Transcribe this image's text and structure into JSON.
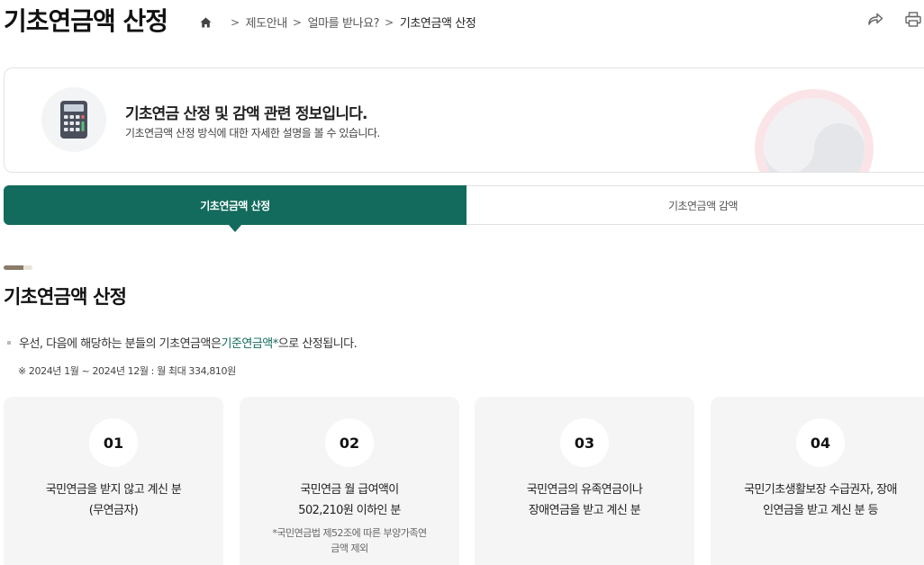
{
  "header": {
    "title": "기초연금액 산정",
    "breadcrumb": [
      "제도안내",
      "얼마를 받나요?",
      "기초연금액 산정"
    ],
    "icons": [
      "home-icon",
      "share-icon",
      "print-icon"
    ]
  },
  "intro": {
    "title": "기초연금 산정 및 감액 관련 정보입니다.",
    "description": "기초연금액 산정 방식에 대한 자세한 설명을 볼 수 있습니다.",
    "icon": "calculator-icon"
  },
  "tabs": [
    {
      "label": "기초연금액 산정",
      "active": true
    },
    {
      "label": "기초연금액 감액",
      "active": false
    }
  ],
  "section": {
    "title": "기초연금액 산정",
    "desc_prefix": "우선, 다음에 해당하는 분들의 기초연금액은 ",
    "desc_highlight": "기준연금액*",
    "desc_suffix": "으로 산정됩니다.",
    "note": "※ 2024년 1월 ~ 2024년 12월 : 월 최대 334,810원"
  },
  "cards": [
    {
      "num": "01",
      "line1": "국민연금을 받지 않고 계신 분",
      "line2": "(무연금자)",
      "sub1": "",
      "sub2": ""
    },
    {
      "num": "02",
      "line1": "국민연금 월 급여액이",
      "line2": "502,210원 이하인 분",
      "sub1": "*국민연금법 제52조에 따른 부양가족연",
      "sub2": "금액 제외"
    },
    {
      "num": "03",
      "line1": "국민연금의 유족연금이나",
      "line2": "장애연금을 받고 계신 분",
      "sub1": "",
      "sub2": ""
    },
    {
      "num": "04",
      "line1": "국민기초생활보장 수급권자, 장애",
      "line2": "인연금을 받고 계신 분 등",
      "sub1": "",
      "sub2": ""
    }
  ],
  "colors": {
    "accent": "#126b5c",
    "card_bg": "#f5f5f6",
    "section_bar": "#8a7c6b"
  }
}
